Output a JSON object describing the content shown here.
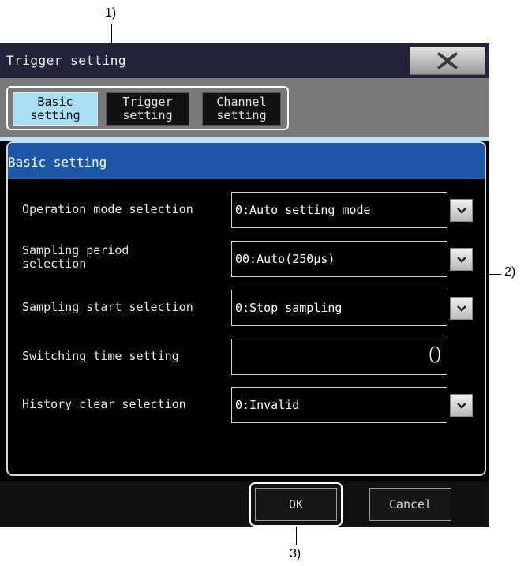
{
  "callouts": {
    "c1": "1)",
    "c2": "2)",
    "c3": "3)"
  },
  "window": {
    "title": "Trigger setting",
    "close_icon": "close-icon"
  },
  "tabs": [
    {
      "label": "Basic\nsetting",
      "active": true
    },
    {
      "label": "Trigger\nsetting",
      "active": false
    },
    {
      "label": "Channel\nsetting",
      "active": false
    }
  ],
  "panel": {
    "title": "Basic setting",
    "rows": [
      {
        "label": "Operation mode selection",
        "value": "0:Auto setting mode",
        "type": "dropdown"
      },
      {
        "label": "Sampling period\nselection",
        "value": "00:Auto(250μs)",
        "type": "dropdown"
      },
      {
        "label": "Sampling start selection",
        "value": "0:Stop sampling",
        "type": "dropdown"
      },
      {
        "label": "Switching time setting",
        "value": "0",
        "type": "numeric"
      },
      {
        "label": "History clear selection",
        "value": "0:Invalid",
        "type": "dropdown"
      }
    ]
  },
  "footer": {
    "ok_label": "OK",
    "cancel_label": "Cancel"
  },
  "colors": {
    "titlebar": "#23233a",
    "tab_active": "#a9dff3",
    "panel_header": "#1e56a8"
  }
}
